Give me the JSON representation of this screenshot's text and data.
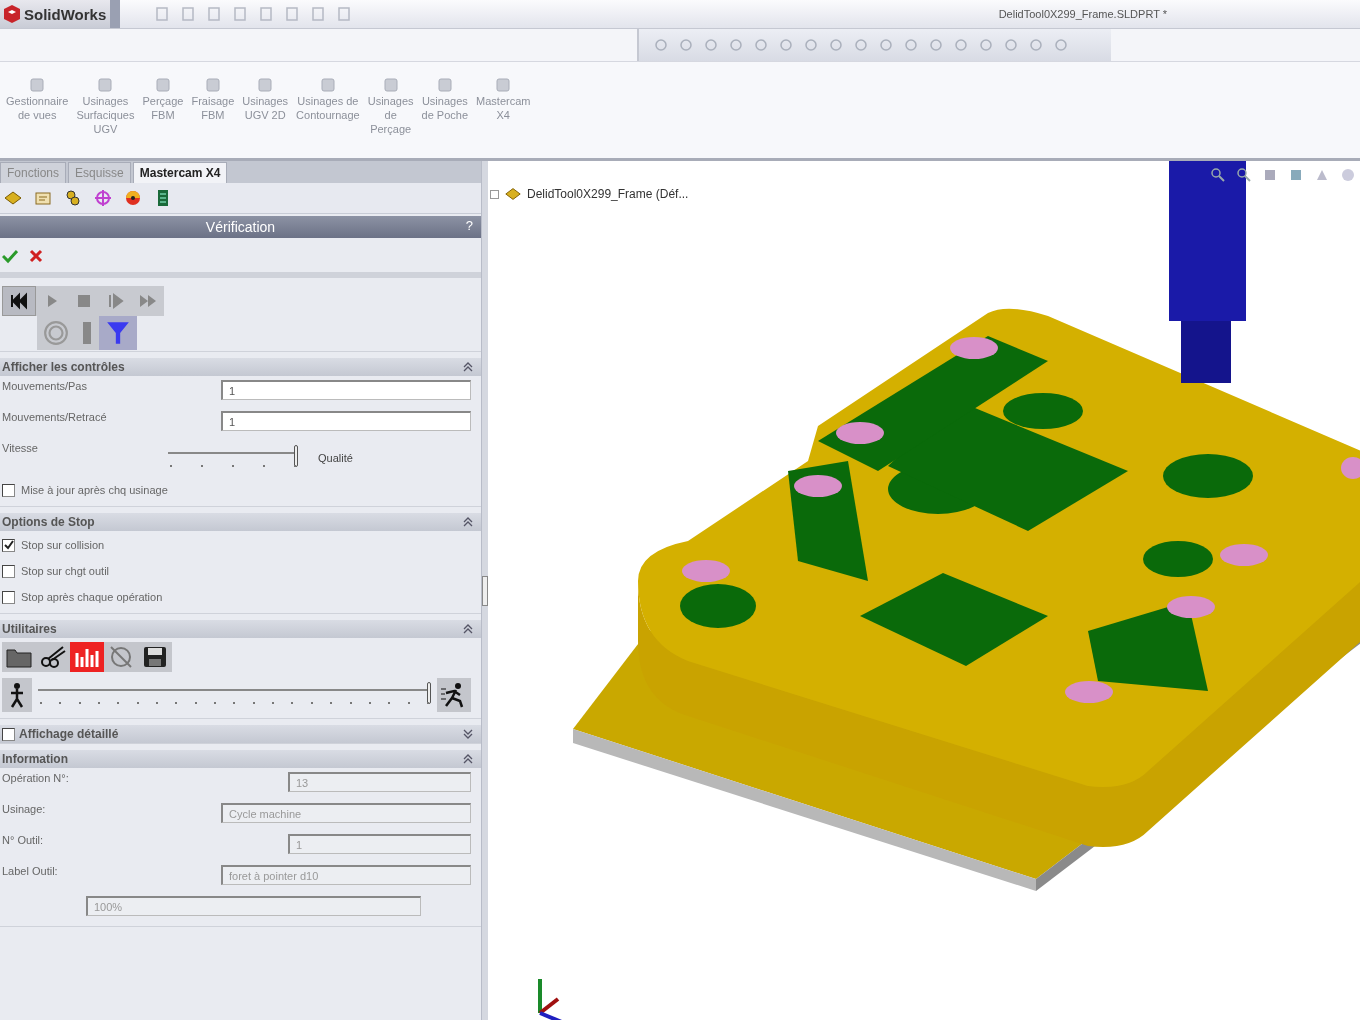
{
  "title_bar": {
    "app_name": "SolidWorks",
    "document_title": "DelidTool0X299_Frame.SLDPRT *"
  },
  "command_manager": [
    {
      "label": "Gestionnaire\nde vues"
    },
    {
      "label": "Usinages\nSurfaciques\nUGV"
    },
    {
      "label": "Perçage\nFBM"
    },
    {
      "label": "Fraisage\nFBM"
    },
    {
      "label": "Usinages\nUGV 2D"
    },
    {
      "label": "Usinages de\nContournage"
    },
    {
      "label": "Usinages\nde\nPerçage"
    },
    {
      "label": "Usinages\nde Poche"
    },
    {
      "label": "Mastercam\nX4"
    }
  ],
  "tabs": [
    {
      "label": "Fonctions",
      "selected": false
    },
    {
      "label": "Esquisse",
      "selected": false
    },
    {
      "label": "Mastercam X4",
      "selected": true
    }
  ],
  "panel": {
    "title": "Vérification",
    "help": "?"
  },
  "sections": [
    {
      "title": "Afficher les contrôles",
      "expanded": true,
      "rows": [
        {
          "kind": "field",
          "label": "Mouvements/Pas",
          "value": "1",
          "disabled": false
        },
        {
          "kind": "field",
          "label": "Mouvements/Retracé",
          "value": "1",
          "disabled": false
        },
        {
          "kind": "slider",
          "label": "Vitesse",
          "end_label": "Qualité",
          "level": 1
        },
        {
          "kind": "checkbox",
          "label": "Mise à jour après chq usinage",
          "checked": false
        }
      ]
    },
    {
      "title": "Options de Stop",
      "expanded": true,
      "rows": [
        {
          "kind": "checkbox",
          "label": "Stop sur collision",
          "checked": true
        },
        {
          "kind": "checkbox",
          "label": "Stop sur chgt outil",
          "checked": false
        },
        {
          "kind": "checkbox",
          "label": "Stop après chaque opération",
          "checked": false
        }
      ]
    },
    {
      "title": "Utilitaires",
      "expanded": true,
      "rows": [
        {
          "kind": "toolbar"
        },
        {
          "kind": "speed_slider",
          "level": 1
        }
      ]
    },
    {
      "title": "Affichage détaillé",
      "expanded": false,
      "checked": false
    },
    {
      "title": "Information",
      "expanded": true,
      "rows": [
        {
          "kind": "short_field",
          "label": "Opération N°:",
          "value": "13",
          "disabled": true
        },
        {
          "kind": "field",
          "label": "Usinage:",
          "value": "Cycle machine",
          "disabled": true
        },
        {
          "kind": "short_field",
          "label": "N° Outil:",
          "value": "1",
          "disabled": true
        },
        {
          "kind": "field",
          "label": "Label Outil:",
          "value": "foret à pointer d10",
          "disabled": true
        },
        {
          "kind": "progress",
          "value": "100%"
        }
      ]
    }
  ],
  "tree": {
    "label": "DelidTool0X299_Frame  (Déf..."
  }
}
